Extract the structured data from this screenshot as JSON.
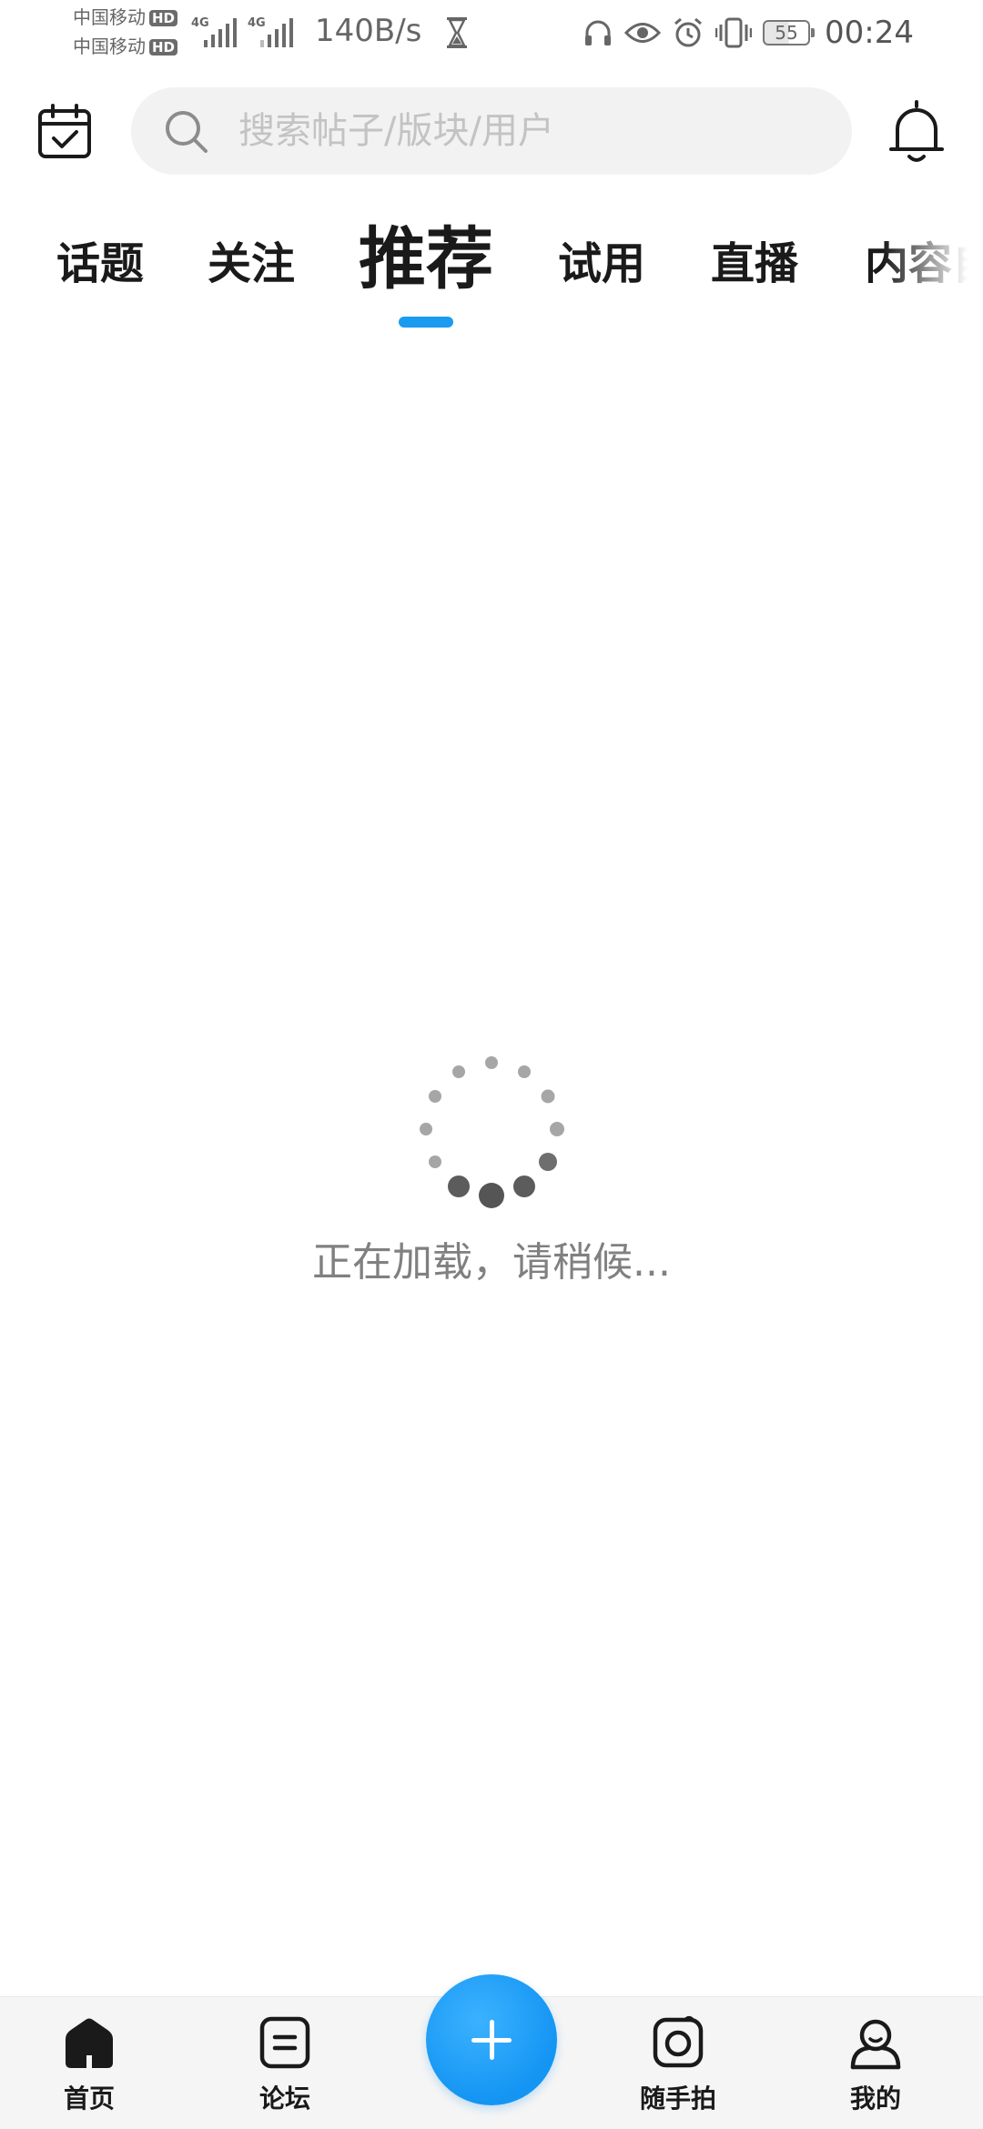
{
  "status_bar": {
    "carrier_1": "中国移动",
    "carrier_2": "中国移动",
    "hd_badge": "HD",
    "network_gen_1": "4G",
    "network_gen_2": "4G",
    "net_speed": "140B/s",
    "battery_level": "55",
    "time": "00:24",
    "icons": [
      "hourglass-icon",
      "headphones-icon",
      "eye-icon",
      "alarm-icon",
      "vibrate-icon",
      "battery-icon"
    ]
  },
  "header": {
    "search_placeholder": "搜索帖子/版块/用户",
    "left_icon": "calendar-check-icon",
    "right_icon": "bell-icon"
  },
  "tabs": {
    "items": [
      {
        "label": "话题",
        "active": false
      },
      {
        "label": "关注",
        "active": false
      },
      {
        "label": "推荐",
        "active": true
      },
      {
        "label": "试用",
        "active": false
      },
      {
        "label": "直播",
        "active": false
      },
      {
        "label": "内容自",
        "active": false
      }
    ],
    "accent_color": "#1a9bf0"
  },
  "loading": {
    "text": "正在加载，请稍候..."
  },
  "bottom_nav": {
    "items": [
      {
        "label": "首页",
        "icon": "home-icon",
        "active": true
      },
      {
        "label": "论坛",
        "icon": "forum-icon",
        "active": false
      },
      {
        "label": "随手拍",
        "icon": "camera-icon",
        "active": false
      },
      {
        "label": "我的",
        "icon": "profile-icon",
        "active": false
      }
    ],
    "fab_icon": "plus-icon",
    "fab_color": "#1495f3"
  }
}
